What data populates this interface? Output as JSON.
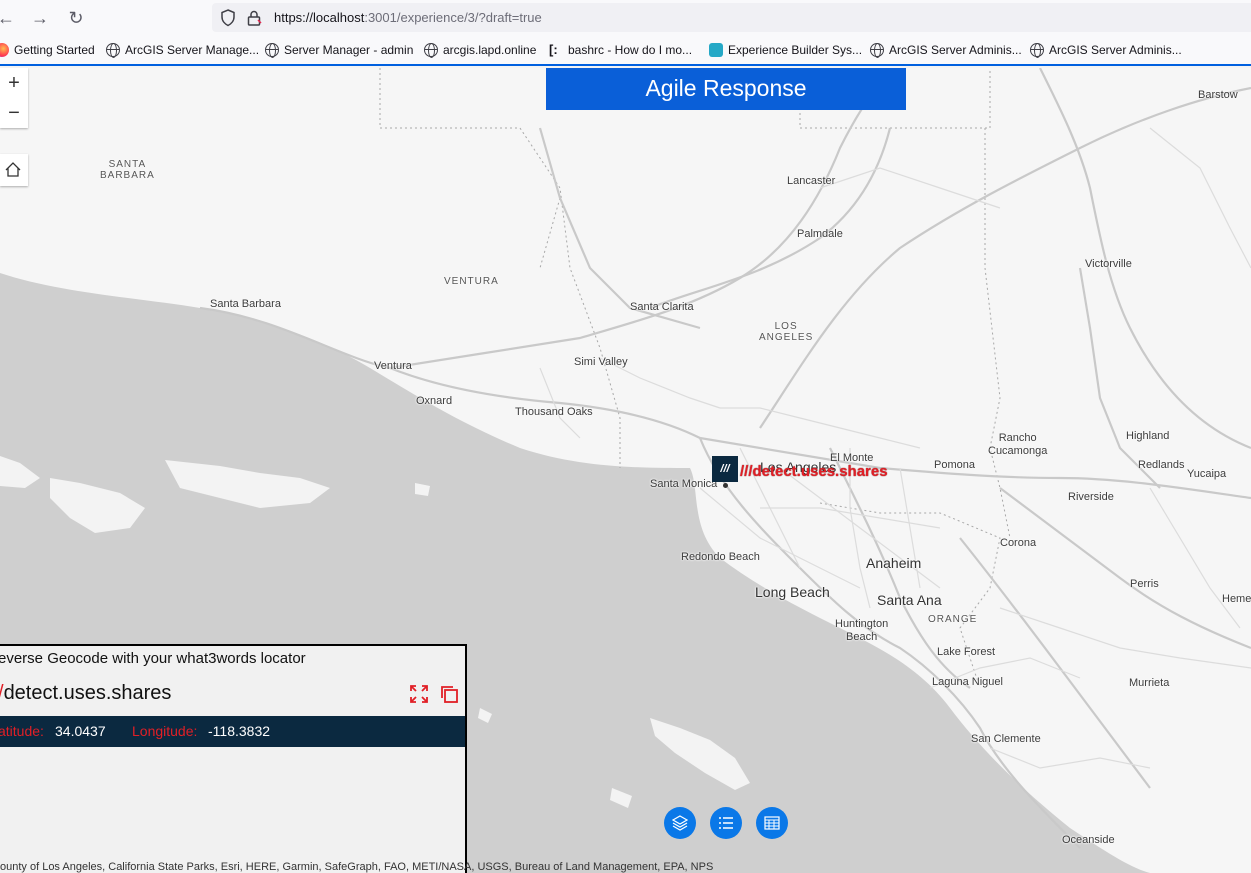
{
  "browser": {
    "url_host": "https://localhost",
    "url_rest": ":3001/experience/3/?draft=true",
    "bookmarks": [
      "Getting Started",
      "ArcGIS Server Manage...",
      "Server Manager - admin",
      "arcgis.lapd.online",
      "bashrc - How do I mo...",
      "Experience Builder Sys...",
      "ArcGIS Server Adminis...",
      "ArcGIS Server Adminis..."
    ]
  },
  "app": {
    "title": "Agile Response"
  },
  "map": {
    "places": {
      "santa_barbara_county": "SANTA\nBARBARA",
      "ventura_county": "VENTURA",
      "la_county": "LOS\nANGELES",
      "orange_county": "ORANGE",
      "barstow": "Barstow",
      "lancaster": "Lancaster",
      "palmdale": "Palmdale",
      "victorville": "Victorville",
      "santa_barbara": "Santa Barbara",
      "santa_clarita": "Santa Clarita",
      "ventura": "Ventura",
      "simi_valley": "Simi Valley",
      "oxnard": "Oxnard",
      "thousand_oaks": "Thousand Oaks",
      "rancho": "Rancho\nCucamonga",
      "highland": "Highland",
      "el_monte": "El Monte",
      "los_angeles": "Los Angeles",
      "pomona": "Pomona",
      "redlands": "Redlands",
      "yucaipa": "Yucaipa",
      "santa_monica": "Santa Monica",
      "riverside": "Riverside",
      "redondo_beach": "Redondo Beach",
      "corona": "Corona",
      "anaheim": "Anaheim",
      "perris": "Perris",
      "hemet": "Heme",
      "long_beach": "Long Beach",
      "santa_ana": "Santa Ana",
      "huntington_beach": "Huntington\nBeach",
      "lake_forest": "Lake Forest",
      "laguna_niguel": "Laguna Niguel",
      "murrieta": "Murrieta",
      "san_clemente": "San Clemente",
      "oceanside": "Oceanside"
    },
    "marker_label": "///detect.uses.shares",
    "marker_glyph": "///",
    "attribution": "ounty of Los Angeles, California State Parks, Esri, HERE, Garmin, SafeGraph, FAO, METI/NASA, USGS, Bureau of Land Management, EPA, NPS"
  },
  "panel": {
    "title": "everse Geocode with your what3words locator",
    "slashes": "/",
    "words": "detect.uses.shares",
    "latitude_label": "atitude:",
    "latitude_value": "34.0437",
    "longitude_label": "Longitude:",
    "longitude_value": "-118.3832"
  },
  "colors": {
    "accent": "#0a5fd8",
    "w3w_red": "#e11f26",
    "navy": "#0b2940",
    "widget_blue": "#0a78e8"
  }
}
